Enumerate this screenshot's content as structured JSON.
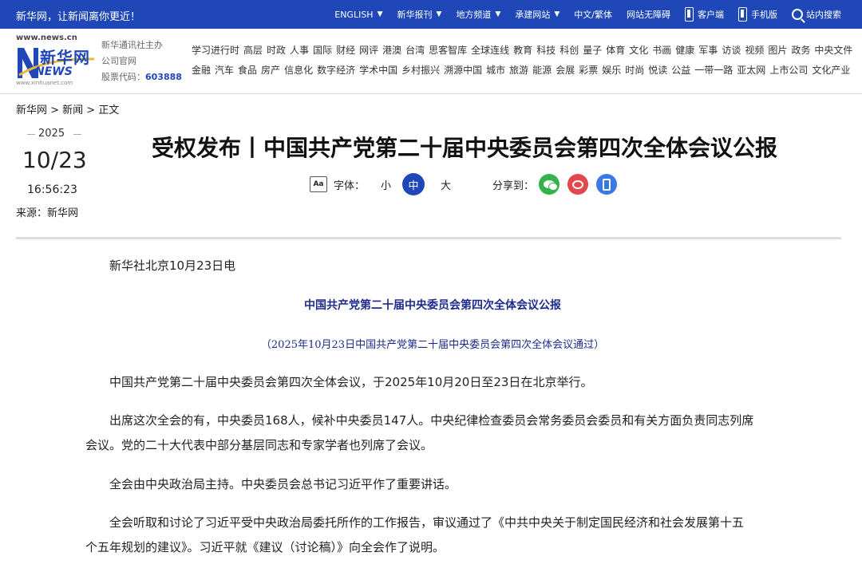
{
  "topbar": {
    "slogan": "新华网，让新闻离你更近！",
    "nav": [
      {
        "label": "ENGLISH",
        "dropdown": true
      },
      {
        "label": "新华报刊",
        "dropdown": true
      },
      {
        "label": "地方频道",
        "dropdown": true
      },
      {
        "label": "承建网站",
        "dropdown": true
      },
      {
        "label": "中文/繁体",
        "dropdown": false
      },
      {
        "label": "网站无障碍",
        "dropdown": false
      },
      {
        "label": "客户端",
        "icon": "phone-icon"
      },
      {
        "label": "手机版",
        "icon": "phone-icon"
      },
      {
        "label": "站内搜索",
        "icon": "search-icon"
      }
    ]
  },
  "header": {
    "logo_url": "www.news.cn",
    "logo_cn": "新华网",
    "logo_news": "NEWS",
    "logo_url2": "www.xinhuanet.com",
    "org_line1": "新华通讯社主办",
    "org_line2": "公司官网",
    "stock_label": "股票代码：",
    "stock_code": "603888",
    "channels_row1": [
      "学习进行时",
      "高层",
      "时政",
      "人事",
      "国际",
      "财经",
      "网评",
      "港澳",
      "台湾",
      "思客智库",
      "全球连线",
      "教育",
      "科技",
      "科创",
      "量子",
      "体育",
      "文化",
      "书画",
      "健康",
      "军事",
      "访谈",
      "视频",
      "图片",
      "政务",
      "中央文件"
    ],
    "channels_row2": [
      "金融",
      "汽车",
      "食品",
      "房产",
      "信息化",
      "数字经济",
      "学术中国",
      "乡村振兴",
      "溯源中国",
      "城市",
      "旅游",
      "能源",
      "会展",
      "彩票",
      "娱乐",
      "时尚",
      "悦读",
      "公益",
      "一带一路",
      "亚太网",
      "上市公司",
      "文化产业"
    ]
  },
  "breadcrumb": "新华网 > 新闻 > 正文",
  "article": {
    "year": "2025",
    "date": "10/23",
    "time": "16:56:23",
    "source": "来源：新华网",
    "title": "受权发布丨中国共产党第二十届中央委员会第四次全体会议公报",
    "font_label": "字体：",
    "font_small": "小",
    "font_medium": "中",
    "font_large": "大",
    "share_label": "分享到：",
    "dateline": "新华社北京10月23日电",
    "subtitle": "中国共产党第二十届中央委员会第四次全体会议公报",
    "subsub": "（2025年10月23日中国共产党第二十届中央委员会第四次全体会议通过）",
    "p1": "中国共产党第二十届中央委员会第四次全体会议，于2025年10月20日至23日在北京举行。",
    "p2a": "出席这次全会的有，中央委员168人，候补中央委员147人。中央纪律检查委员会常务委员会委员和有关方面负责同志列席",
    "p2b": "会议。党的二十大代表中部分基层同志和专家学者也列席了会议。",
    "p3": "全会由中央政治局主持。中央委员会总书记习近平作了重要讲话。",
    "p4a": "全会听取和讨论了习近平受中央政治局委托所作的工作报告，审议通过了《中共中央关于制定国民经济和社会发展第十五",
    "p4b": "个五年规划的建议》。习近平就《建议（讨论稿）》向全会作了说明。"
  },
  "colors": {
    "brand_blue": "#1f47b8",
    "heading_navy": "#1e2b8c",
    "wechat": "#36b24a",
    "weibo": "#e0484b",
    "mobile": "#3a78e6"
  }
}
